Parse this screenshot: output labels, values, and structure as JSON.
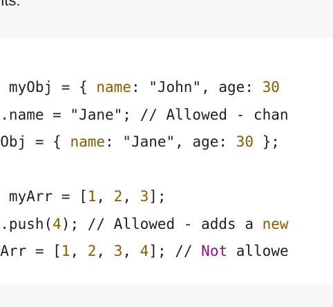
{
  "prose": {
    "fragment": "nts:"
  },
  "code": {
    "lines": [
      [
        {
          "text": "st myObj = { ",
          "kind": "plain"
        },
        {
          "text": "name",
          "kind": "prop"
        },
        {
          "text": ": \"John\", age: ",
          "kind": "plain"
        },
        {
          "text": "30",
          "kind": "num"
        }
      ],
      [
        {
          "text": "oj.name = \"Jane\"; // Allowed - chan",
          "kind": "plain"
        }
      ],
      [
        {
          "text": "nyObj = { ",
          "kind": "plain"
        },
        {
          "text": "name",
          "kind": "prop"
        },
        {
          "text": ": \"Jane\", age: ",
          "kind": "plain"
        },
        {
          "text": "30",
          "kind": "num"
        },
        {
          "text": " };",
          "kind": "plain"
        }
      ],
      [],
      [
        {
          "text": "st myArr = [",
          "kind": "plain"
        },
        {
          "text": "1",
          "kind": "num"
        },
        {
          "text": ", ",
          "kind": "plain"
        },
        {
          "text": "2",
          "kind": "num"
        },
        {
          "text": ", ",
          "kind": "plain"
        },
        {
          "text": "3",
          "kind": "num"
        },
        {
          "text": "];",
          "kind": "plain"
        }
      ],
      [
        {
          "text": "rr.push(",
          "kind": "plain"
        },
        {
          "text": "4",
          "kind": "num"
        },
        {
          "text": "); // Allowed - adds a ",
          "kind": "plain"
        },
        {
          "text": "new",
          "kind": "prop"
        }
      ],
      [
        {
          "text": "nyArr = [",
          "kind": "plain"
        },
        {
          "text": "1",
          "kind": "num"
        },
        {
          "text": ", ",
          "kind": "plain"
        },
        {
          "text": "2",
          "kind": "num"
        },
        {
          "text": ", ",
          "kind": "plain"
        },
        {
          "text": "3",
          "kind": "num"
        },
        {
          "text": ", ",
          "kind": "plain"
        },
        {
          "text": "4",
          "kind": "num"
        },
        {
          "text": "]; // ",
          "kind": "plain"
        },
        {
          "text": "Not",
          "kind": "kw"
        },
        {
          "text": " allowe",
          "kind": "plain"
        }
      ]
    ]
  },
  "colors": {
    "page_background": "#f7f7f8",
    "code_background": "#ffffff",
    "text": "#1f1f1f",
    "number": "#8a5a00",
    "property": "#8a5a00",
    "keyword": "#9b0e89"
  }
}
